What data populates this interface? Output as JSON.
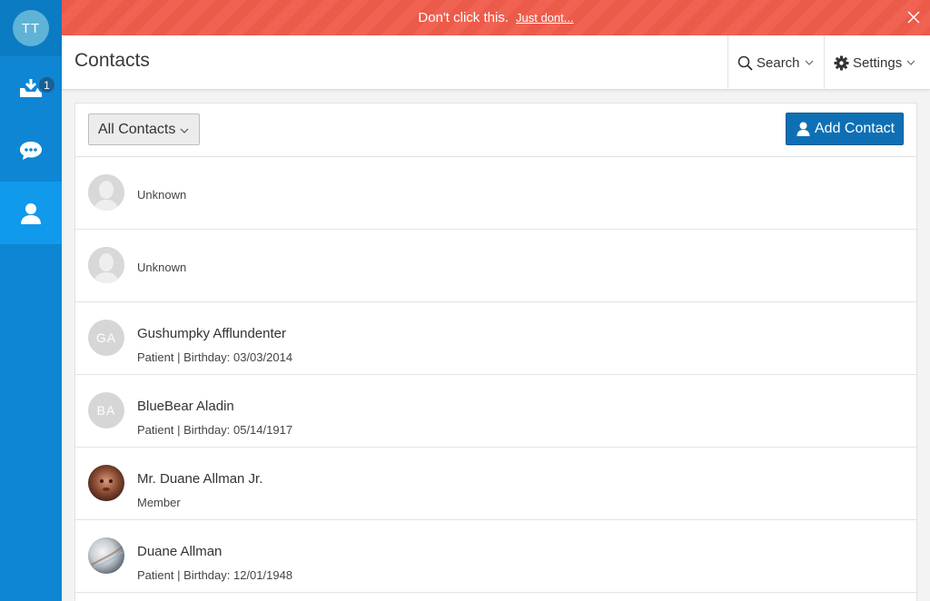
{
  "user": {
    "initials": "TT"
  },
  "sidebar": {
    "items": [
      {
        "icon": "inbox-download-icon",
        "badge": "1"
      },
      {
        "icon": "chat-bubble-icon"
      },
      {
        "icon": "user-icon",
        "active": true
      }
    ]
  },
  "banner": {
    "message": "Don't click this.",
    "link": "Just dont..."
  },
  "header": {
    "title": "Contacts",
    "search_label": "Search",
    "settings_label": "Settings"
  },
  "toolbar": {
    "filter_label": "All Contacts",
    "add_label": "Add Contact"
  },
  "contacts": [
    {
      "name": "Unknown",
      "subtitle": "",
      "avatar": "silhouette"
    },
    {
      "name": "Unknown",
      "subtitle": "",
      "avatar": "silhouette"
    },
    {
      "name": "Gushumpky Afflundenter",
      "subtitle": "Patient | Birthday: 03/03/2014",
      "avatar": "initials",
      "initials": "GA"
    },
    {
      "name": "BlueBear Aladin",
      "subtitle": "Patient | Birthday: 05/14/1917",
      "avatar": "initials",
      "initials": "BA"
    },
    {
      "name": "Mr. Duane Allman Jr.",
      "subtitle": "Member",
      "avatar": "photo"
    },
    {
      "name": "Duane Allman",
      "subtitle": "Patient | Birthday: 12/01/1948",
      "avatar": "photo"
    }
  ],
  "colors": {
    "sidebar": "#0e86d4",
    "banner": "#ec5a4a",
    "primary_button": "#0f6fb4"
  }
}
